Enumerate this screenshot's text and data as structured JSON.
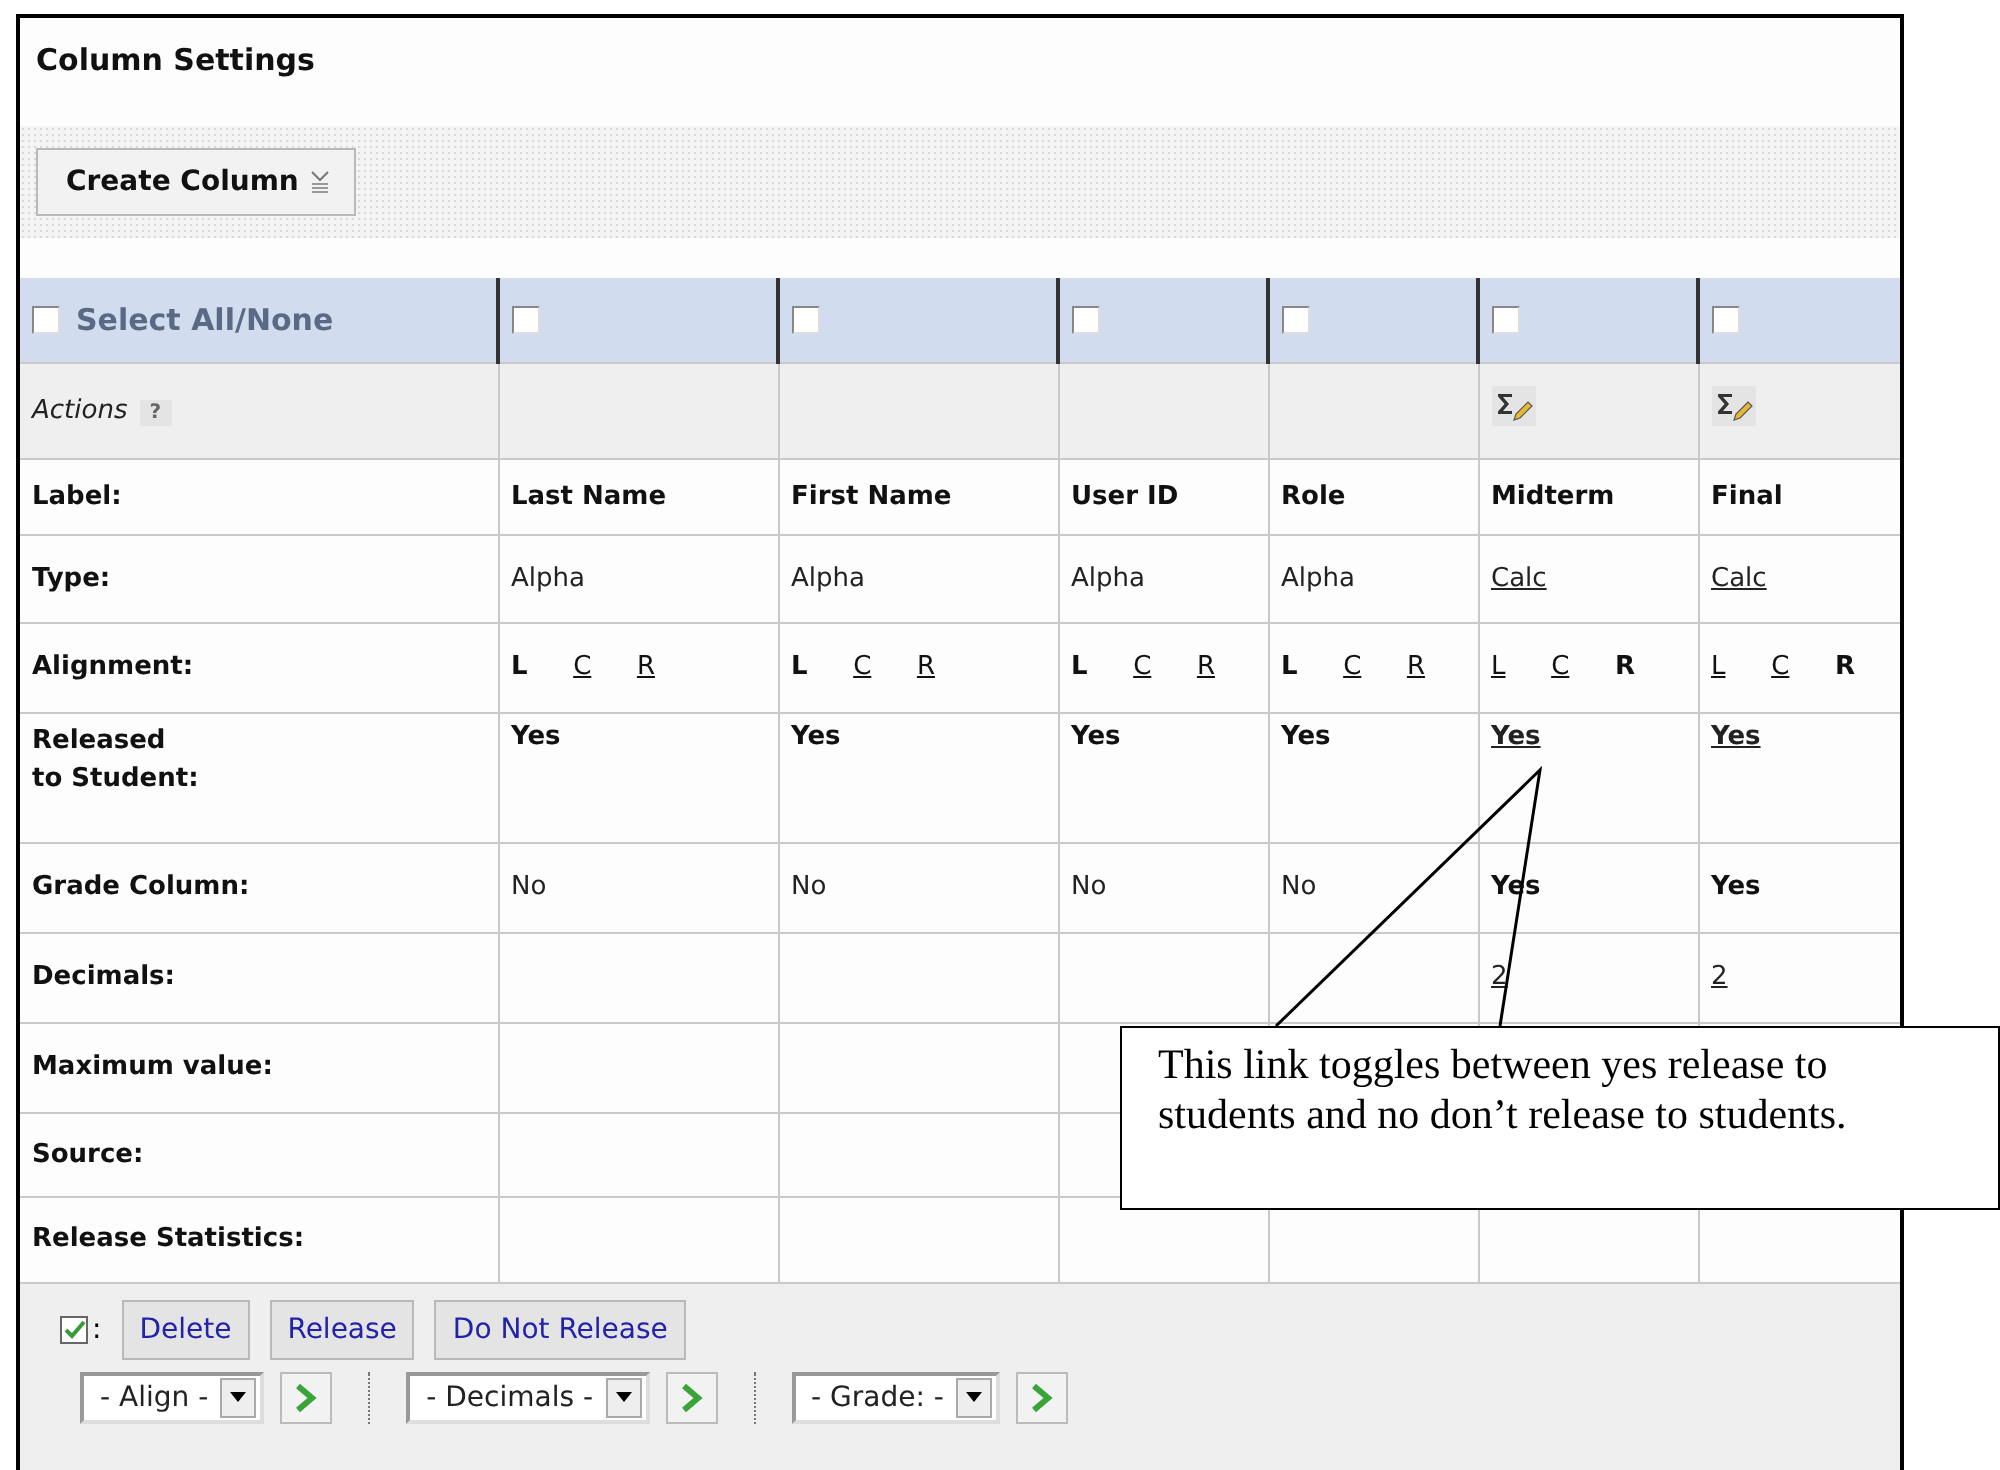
{
  "title": "Column Settings",
  "toolbar": {
    "create_button": "Create Column"
  },
  "select_all": {
    "label": "Select All/None",
    "checked": false
  },
  "actions_label": "Actions",
  "help_mark": "?",
  "row_labels": [
    "Label:",
    "Type:",
    "Alignment:",
    "Released\nto Student:",
    "Grade Column:",
    "Decimals:",
    "Maximum value:",
    "Source:",
    "Release Statistics:"
  ],
  "columns": [
    {
      "checked": false,
      "calc_icon": false,
      "label": "Last Name",
      "type": {
        "text": "Alpha",
        "link": false
      },
      "alignment": [
        {
          "label": "L",
          "selected": true
        },
        {
          "label": "C",
          "selected": false
        },
        {
          "label": "R",
          "selected": false
        }
      ],
      "released": {
        "text": "Yes",
        "link": false
      },
      "grade": {
        "text": "No",
        "on": false
      }
    },
    {
      "checked": false,
      "calc_icon": false,
      "label": "First Name",
      "type": {
        "text": "Alpha",
        "link": false
      },
      "alignment": [
        {
          "label": "L",
          "selected": true
        },
        {
          "label": "C",
          "selected": false
        },
        {
          "label": "R",
          "selected": false
        }
      ],
      "released": {
        "text": "Yes",
        "link": false
      },
      "grade": {
        "text": "No",
        "on": false
      }
    },
    {
      "checked": false,
      "calc_icon": false,
      "label": "User ID",
      "type": {
        "text": "Alpha",
        "link": false
      },
      "alignment": [
        {
          "label": "L",
          "selected": true
        },
        {
          "label": "C",
          "selected": false
        },
        {
          "label": "R",
          "selected": false
        }
      ],
      "released": {
        "text": "Yes",
        "link": false
      },
      "grade": {
        "text": "No",
        "on": false
      }
    },
    {
      "checked": false,
      "calc_icon": false,
      "label": "Role",
      "type": {
        "text": "Alpha",
        "link": false
      },
      "alignment": [
        {
          "label": "L",
          "selected": true
        },
        {
          "label": "C",
          "selected": false
        },
        {
          "label": "R",
          "selected": false
        }
      ],
      "released": {
        "text": "Yes",
        "link": false
      },
      "grade": {
        "text": "No",
        "on": false
      }
    },
    {
      "checked": false,
      "calc_icon": true,
      "label": "Midterm",
      "type": {
        "text": "Calc",
        "link": true
      },
      "alignment": [
        {
          "label": "L",
          "selected": false
        },
        {
          "label": "C",
          "selected": false
        },
        {
          "label": "R",
          "selected": true
        }
      ],
      "released": {
        "text": "Yes",
        "link": true
      },
      "grade": {
        "text": "Yes",
        "on": true
      },
      "decimals": "2"
    },
    {
      "checked": false,
      "calc_icon": true,
      "label": "Final",
      "type": {
        "text": "Calc",
        "link": true
      },
      "alignment": [
        {
          "label": "L",
          "selected": false
        },
        {
          "label": "C",
          "selected": false
        },
        {
          "label": "R",
          "selected": true
        }
      ],
      "released": {
        "text": "Yes",
        "link": true
      },
      "grade": {
        "text": "Yes",
        "on": true
      },
      "decimals": "2"
    }
  ],
  "footer": {
    "colon": ":",
    "buttons": [
      "Delete",
      "Release",
      "Do Not Release"
    ],
    "selects": [
      {
        "value": "- Align -"
      },
      {
        "value": "- Decimals -"
      },
      {
        "value": "- Grade: -"
      }
    ]
  },
  "callout": {
    "text": "This link toggles between yes release to students and no don’t release to students."
  }
}
